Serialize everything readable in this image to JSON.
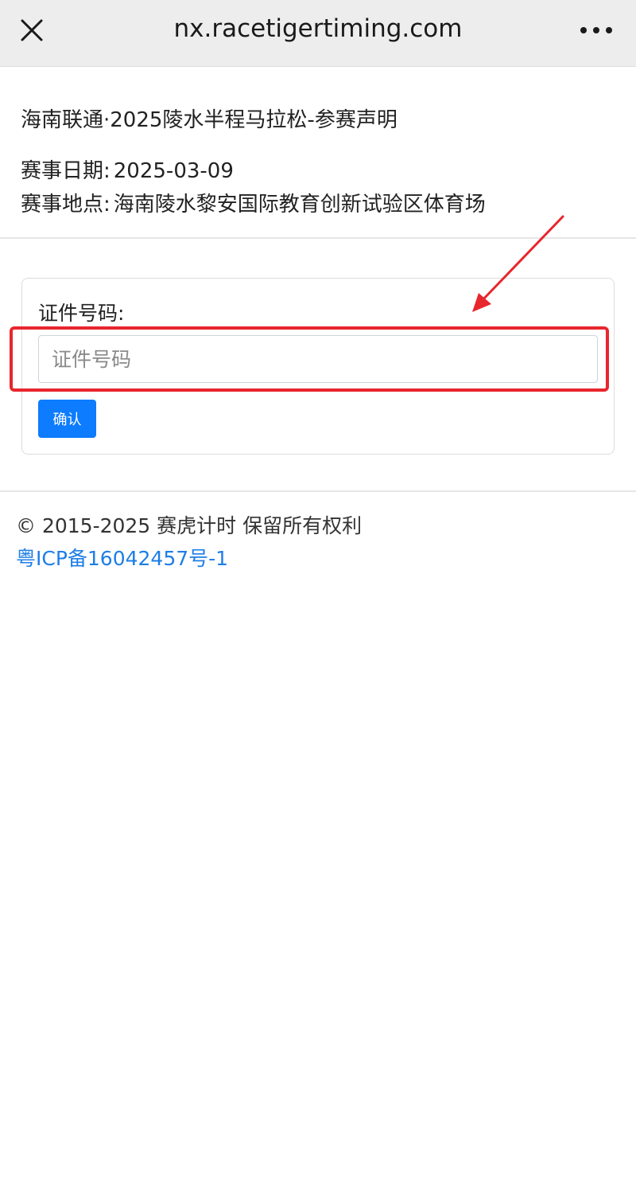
{
  "browser": {
    "url_title": "nx.racetigertiming.com"
  },
  "event": {
    "title": "海南联通·2025陵水半程马拉松-参赛声明",
    "date_label": "赛事日期:",
    "date_value": "2025-03-09",
    "location_label": "赛事地点:",
    "location_value": "海南陵水黎安国际教育创新试验区体育场"
  },
  "form": {
    "id_label": "证件号码:",
    "id_placeholder": "证件号码",
    "id_value": "",
    "confirm_label": "确认"
  },
  "footer": {
    "copyright": "© 2015-2025 赛虎计时 保留所有权利",
    "icp": "粤ICP备16042457号-1"
  },
  "colors": {
    "button_primary": "#0d7cff",
    "annotation_red": "#e8262d",
    "link_blue": "#1e7ee6",
    "topbar_bg": "#ededed"
  },
  "icons": {
    "close": "close-icon",
    "more": "more-dots-icon"
  }
}
